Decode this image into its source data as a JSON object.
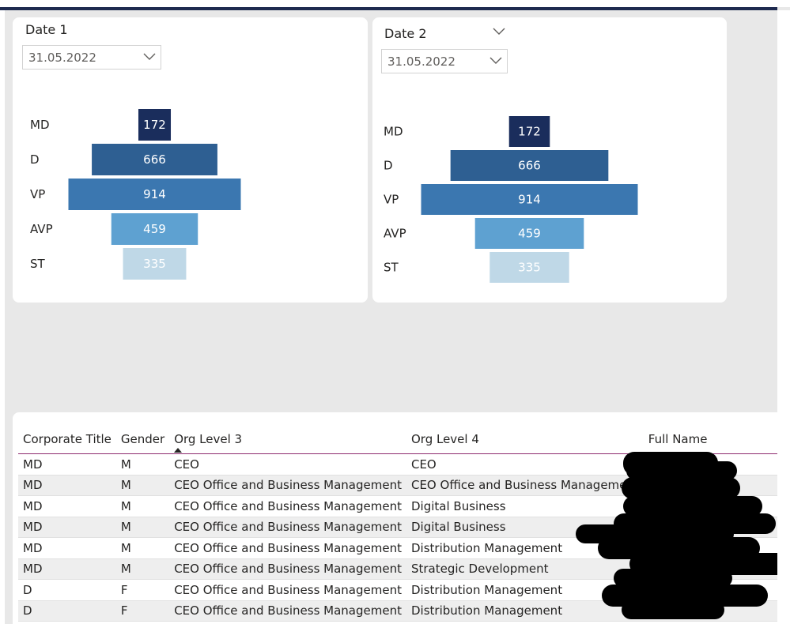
{
  "slicers": [
    {
      "title": "Date 1",
      "value": "31.05.2022"
    },
    {
      "title": "Date 2",
      "value": "31.05.2022"
    }
  ],
  "chart_data": [
    {
      "type": "bar",
      "orientation": "funnel",
      "categories": [
        "MD",
        "D",
        "VP",
        "AVP",
        "ST"
      ],
      "values": [
        172,
        666,
        914,
        459,
        335
      ],
      "colors": [
        "#1a2d5c",
        "#2e5f92",
        "#3b77b0",
        "#5ea1d1",
        "#bfd8e7"
      ]
    },
    {
      "type": "bar",
      "orientation": "funnel",
      "categories": [
        "MD",
        "D",
        "VP",
        "AVP",
        "ST"
      ],
      "values": [
        172,
        666,
        914,
        459,
        335
      ],
      "colors": [
        "#1a2d5c",
        "#2e5f92",
        "#3b77b0",
        "#5ea1d1",
        "#bfd8e7"
      ]
    }
  ],
  "table": {
    "columns": [
      "Corporate Title",
      "Gender",
      "Org Level 3",
      "Org Level 4",
      "Full Name"
    ],
    "rows": [
      [
        "MD",
        "M",
        "CEO",
        "CEO",
        ""
      ],
      [
        "MD",
        "M",
        "CEO Office and Business Management",
        "CEO Office and Business Management",
        ""
      ],
      [
        "MD",
        "M",
        "CEO Office and Business Management",
        "Digital Business",
        ""
      ],
      [
        "MD",
        "M",
        "CEO Office and Business Management",
        "Digital Business",
        ""
      ],
      [
        "MD",
        "M",
        "CEO Office and Business Management",
        "Distribution Management",
        ""
      ],
      [
        "MD",
        "M",
        "CEO Office and Business Management",
        "Strategic Development",
        ""
      ],
      [
        "D",
        "F",
        "CEO Office and Business Management",
        "Distribution Management",
        ""
      ],
      [
        "D",
        "F",
        "CEO Office and Business Management",
        "Distribution Management",
        ""
      ]
    ]
  },
  "colors": {
    "header_line": "#1e2a4f",
    "table_header_border": "#8e2a6f"
  }
}
